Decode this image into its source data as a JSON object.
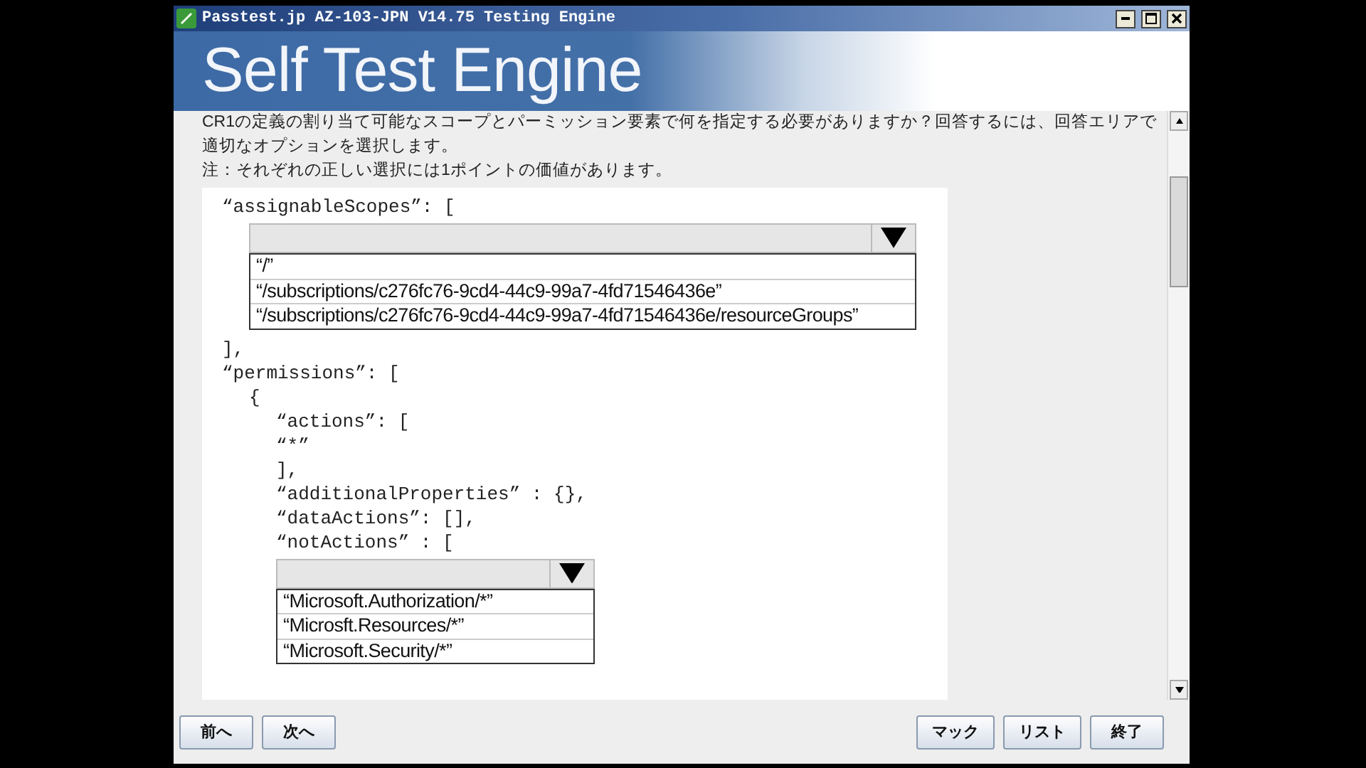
{
  "window": {
    "title": "Passtest.jp AZ-103-JPN V14.75 Testing Engine"
  },
  "banner": {
    "title": "Self Test Engine"
  },
  "question": {
    "lines": [
      "CR1の定義の割り当て可能なスコープとパーミッション要素で何を指定する必要がありますか？回答するには、回答エリアで",
      "適切なオプションを選択します。",
      "注：それぞれの正しい選択には1ポイントの価値があります。"
    ]
  },
  "code": [
    {
      "kind": "text",
      "text": "“assignableScopes”: [",
      "children": [
        {
          "kind": "dropdown",
          "options": [
            {
              "label": "“/”"
            },
            {
              "label": "“/subscriptions/c276fc76-9cd4-44c9-99a7-4fd71546436e”"
            },
            {
              "label": "“/subscriptions/c276fc76-9cd4-44c9-99a7-4fd71546436e/resourceGroups”"
            }
          ]
        }
      ]
    },
    {
      "kind": "text",
      "text": "],"
    },
    {
      "kind": "text",
      "text": "“permissions”: [",
      "children": [
        {
          "kind": "text",
          "text": "{",
          "children": [
            {
              "kind": "text",
              "text": "“actions”: ["
            },
            {
              "kind": "text",
              "text": "“*”"
            },
            {
              "kind": "text",
              "text": "],"
            },
            {
              "kind": "text",
              "text": "“additionalProperties” : {},"
            },
            {
              "kind": "text",
              "text": "“dataActions”: [],"
            },
            {
              "kind": "text",
              "text": "“notActions” : ["
            },
            {
              "kind": "dropdown",
              "options": [
                {
                  "label": "“Microsoft.Authorization/*”"
                },
                {
                  "label": "“Microsft.Resources/*”"
                },
                {
                  "label": "“Microsoft.Security/*”"
                }
              ]
            }
          ]
        }
      ]
    }
  ],
  "buttons_left": [
    "前へ",
    "次へ"
  ],
  "buttons_right": [
    "マック",
    "リスト",
    "終了"
  ]
}
